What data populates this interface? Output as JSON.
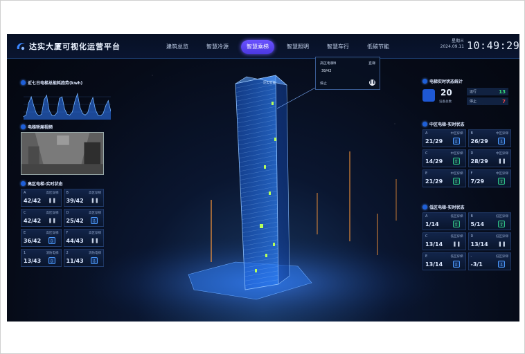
{
  "header": {
    "title": "达实大厦可视化运营平台",
    "nav": [
      "建筑总览",
      "智慧冷源",
      "智慧乘梯",
      "智慧照明",
      "智慧车行",
      "低碳节能"
    ],
    "active_nav": "智慧乘梯",
    "weekday": "星期三",
    "date": "2024.09.11",
    "time": "10:49:29"
  },
  "left": {
    "chart_title": "近七日电梯总能耗趋势(kwh)",
    "video_title": "电梯轿厢视频",
    "high_zone_title": "高区电梯-实时状态",
    "high_zone_elevators": [
      {
        "id": "A",
        "zone": "高区穿梯",
        "floor": "42/42",
        "state": "pause",
        "glyph": "❚❚"
      },
      {
        "id": "B",
        "zone": "高区穿梯",
        "floor": "39/42",
        "state": "pause",
        "glyph": "❚❚"
      },
      {
        "id": "C",
        "zone": "高区穿梯",
        "floor": "42/42",
        "state": "pause",
        "glyph": "❚❚"
      },
      {
        "id": "D",
        "zone": "高区穿梯",
        "floor": "25/42",
        "state": "down",
        "glyph": "⇩"
      },
      {
        "id": "E",
        "zone": "高区穿梯",
        "floor": "36/42",
        "state": "down",
        "glyph": "⇩"
      },
      {
        "id": "F",
        "zone": "高区穿梯",
        "floor": "44/43",
        "state": "pause",
        "glyph": "❚❚"
      },
      {
        "id": "1",
        "zone": "消防电梯",
        "floor": "13/43",
        "state": "down",
        "glyph": "⇩"
      },
      {
        "id": "2",
        "zone": "消防电梯",
        "floor": "11/43",
        "state": "down",
        "glyph": "⇩"
      }
    ]
  },
  "center": {
    "building_label": "达实智能",
    "popup": {
      "name": "高区电梯B",
      "direction": "直梯",
      "floor": "39/42",
      "status": "停止",
      "glyph": "❚❚"
    }
  },
  "right": {
    "status_title": "电梯实时状态统计",
    "total": "20",
    "total_label": "设备总数",
    "running_label": "运行",
    "running": "13",
    "stopped_label": "停止",
    "stopped": "7",
    "mid_zone_title": "中区电梯-实时状态",
    "mid_zone_elevators": [
      {
        "id": "A",
        "zone": "中区穿梯",
        "floor": "21/29",
        "state": "down",
        "glyph": "⇩"
      },
      {
        "id": "B",
        "zone": "中区穿梯",
        "floor": "26/29",
        "state": "down",
        "glyph": "⇩"
      },
      {
        "id": "C",
        "zone": "中区穿梯",
        "floor": "14/29",
        "state": "up",
        "glyph": "⇧"
      },
      {
        "id": "D",
        "zone": "中区穿梯",
        "floor": "28/29",
        "state": "pause",
        "glyph": "❚❚"
      },
      {
        "id": "E",
        "zone": "中区穿梯",
        "floor": "21/29",
        "state": "up",
        "glyph": "⇧"
      },
      {
        "id": "F",
        "zone": "中区穿梯",
        "floor": "7/29",
        "state": "up",
        "glyph": "⇧"
      }
    ],
    "low_zone_title": "低区电梯-实时状态",
    "low_zone_elevators": [
      {
        "id": "A",
        "zone": "低区穿梯",
        "floor": "1/14",
        "state": "up",
        "glyph": "⇧"
      },
      {
        "id": "B",
        "zone": "低区穿梯",
        "floor": "5/14",
        "state": "up",
        "glyph": "⇧"
      },
      {
        "id": "C",
        "zone": "低区穿梯",
        "floor": "13/14",
        "state": "pause",
        "glyph": "❚❚"
      },
      {
        "id": "D",
        "zone": "低区穿梯",
        "floor": "13/14",
        "state": "pause",
        "glyph": "❚❚"
      },
      {
        "id": "E",
        "zone": "低区穿梯",
        "floor": "13/14",
        "state": "down",
        "glyph": "⇩"
      },
      {
        "id": "-",
        "zone": "低区穿梯",
        "floor": "-3/1",
        "state": "down",
        "glyph": "⇩"
      }
    ]
  },
  "chart_data": {
    "type": "area",
    "title": "近七日电梯总能耗趋势(kwh)",
    "values": [
      4,
      6,
      22,
      30,
      18,
      8,
      5,
      7,
      26,
      32,
      12,
      6,
      5,
      9,
      28,
      30,
      14,
      7,
      6,
      10,
      24,
      34,
      16,
      8,
      6,
      9,
      21,
      29,
      13,
      6,
      5,
      8,
      18,
      25,
      11
    ],
    "ylim": [
      0,
      40
    ]
  },
  "colors": {
    "accent": "#5b45f0",
    "up": "#2fc489",
    "down": "#4d9cff",
    "running": "#38e07e",
    "stopped": "#ff4a4a"
  }
}
